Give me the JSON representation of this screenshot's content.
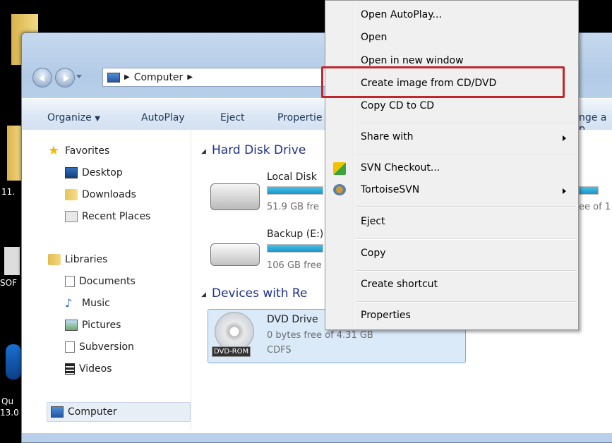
{
  "desktop": {
    "labels": [
      "11.",
      "SOF",
      "Qu",
      "13.0"
    ]
  },
  "window": {
    "breadcrumb": "Computer",
    "toolbar": {
      "organize": "Organize",
      "autoplay": "AutoPlay",
      "eject": "Eject",
      "properties": "Propertie",
      "change": "nge a p"
    }
  },
  "sidebar": {
    "favorites": "Favorites",
    "desktop": "Desktop",
    "downloads": "Downloads",
    "recent": "Recent Places",
    "libraries": "Libraries",
    "documents": "Documents",
    "music": "Music",
    "pictures": "Pictures",
    "subversion": "Subversion",
    "videos": "Videos",
    "computer": "Computer"
  },
  "main": {
    "hard_disk_header": "Hard Disk Drive",
    "devices_header": "Devices with Re",
    "drives": [
      {
        "name": "Local Disk",
        "free": "51.9 GB fre",
        "right_text": "ee of 1",
        "fill": 0.82
      },
      {
        "name": "Backup (E:)",
        "free": "106 GB free",
        "fill": 0.5
      }
    ],
    "dvd": {
      "name": "DVD Drive",
      "free": "0 bytes free of 4.31 GB",
      "fs": "CDFS",
      "badge": "DVD-ROM"
    }
  },
  "context_menu": {
    "items": [
      "Open AutoPlay...",
      "Open",
      "Open in new window",
      "Create image from CD/DVD",
      "Copy CD to CD",
      "Share with",
      "SVN Checkout...",
      "TortoiseSVN",
      "Eject",
      "Copy",
      "Create shortcut",
      "Properties"
    ]
  },
  "colors": {
    "highlight_box": "#c0272d",
    "bar_fill": "#1c96c9",
    "selection": "#dbeaf9"
  }
}
